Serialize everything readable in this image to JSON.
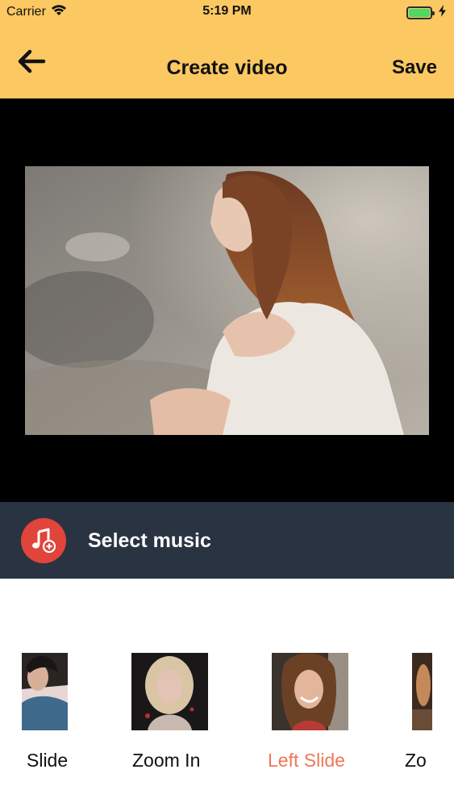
{
  "status_bar": {
    "carrier": "Carrier",
    "time": "5:19 PM",
    "battery_level": 1.0
  },
  "nav": {
    "title": "Create video",
    "save_label": "Save",
    "back_icon": "arrow-left-icon"
  },
  "music": {
    "label": "Select music",
    "icon": "music-note-add-icon"
  },
  "effects": [
    {
      "label": "Slide",
      "selected": false
    },
    {
      "label": "Zoom In",
      "selected": false
    },
    {
      "label": "Left Slide",
      "selected": true
    },
    {
      "label": "Zo",
      "selected": false
    }
  ],
  "colors": {
    "header": "#fcc862",
    "music_bar": "#2a3342",
    "music_icon": "#e0443b",
    "selected_effect": "#ed7856",
    "battery": "#4cd964"
  }
}
